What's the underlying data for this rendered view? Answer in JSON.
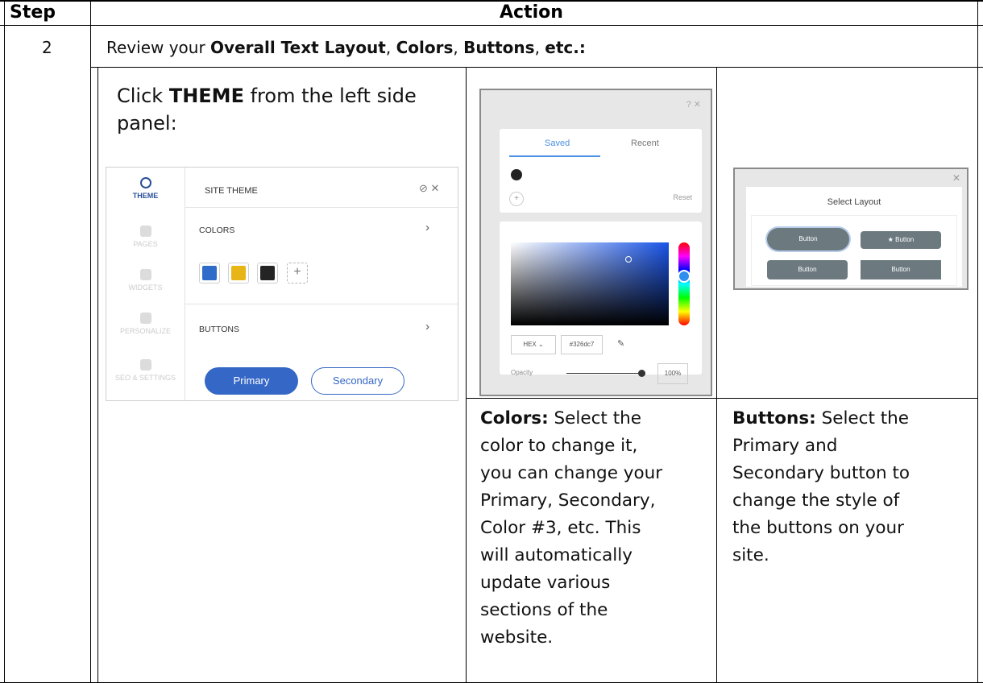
{
  "table": {
    "header_step": "Step",
    "header_action": "Action",
    "step_number": "2",
    "review_text": {
      "prefix": "Review your ",
      "b1": "Overall Text Layout",
      "sep1": ", ",
      "b2": "Colors",
      "sep2": ", ",
      "b3": "Buttons",
      "sep3": ", ",
      "b4": "etc.:"
    }
  },
  "theme_instruction": {
    "prefix": "Click ",
    "bold": "THEME",
    "suffix": " from the left side panel:"
  },
  "theme_panel": {
    "tools": [
      "THEME",
      "PAGES",
      "WIDGETS",
      "PERSONALIZE",
      "SEO & SETTINGS"
    ],
    "title": "SITE THEME",
    "help_close": "⊘  ✕",
    "colors_label": "COLORS",
    "buttons_label": "BUTTONS",
    "chevron": "›",
    "swatch_colors": [
      "#2f6cc9",
      "#e8b516",
      "#242424"
    ],
    "add_symbol": "+",
    "primary_label": "Primary",
    "secondary_label": "Secondary"
  },
  "color_picker": {
    "top_controls": "?  ✕",
    "tab_saved": "Saved",
    "tab_recent": "Recent",
    "add_symbol": "+",
    "reset": "Reset",
    "format": "HEX  ⌄",
    "hex_value": "#326dc7",
    "dropper": "✎",
    "opacity_label": "Opacity",
    "opacity_value": "100%"
  },
  "layout_picker": {
    "close": "✕",
    "title": "Select Layout",
    "button_label": "Button",
    "star_button_label": "★  Button"
  },
  "captions": {
    "colors_bold": "Colors:",
    "colors_lines": [
      " Select the",
      "color to change it,",
      "you can change your",
      "Primary, Secondary,",
      "Color #3, etc. This",
      "will automatically",
      "update various",
      "sections of the",
      "website."
    ],
    "buttons_bold": "Buttons:",
    "buttons_lines": [
      " Select the",
      "Primary and",
      "Secondary button to",
      "change the style of",
      "the buttons on your",
      "site."
    ]
  }
}
